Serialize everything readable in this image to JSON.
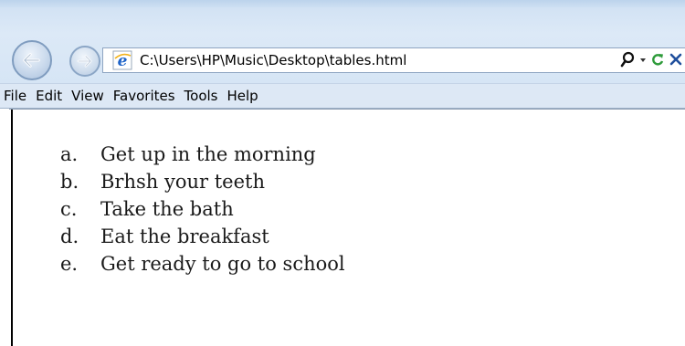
{
  "address_bar": {
    "url": "C:\\Users\\HP\\Music\\Desktop\\tables.html"
  },
  "toolbar_icons": {
    "back": "back-arrow-icon",
    "forward": "forward-arrow-icon",
    "page": "ie-logo-icon",
    "search": "search-icon",
    "dropdown": "dropdown-arrow-icon",
    "refresh": "refresh-icon",
    "stop": "close-icon"
  },
  "menu": {
    "items": [
      {
        "label": "File"
      },
      {
        "label": "Edit"
      },
      {
        "label": "View"
      },
      {
        "label": "Favorites"
      },
      {
        "label": "Tools"
      },
      {
        "label": "Help"
      }
    ]
  },
  "page": {
    "list": [
      {
        "marker": "a.",
        "text": "Get up in the morning"
      },
      {
        "marker": "b.",
        "text": "Brhsh your teeth"
      },
      {
        "marker": "c.",
        "text": "Take the bath"
      },
      {
        "marker": "d.",
        "text": "Eat the breakfast"
      },
      {
        "marker": "e.",
        "text": "Get ready to go to school"
      }
    ]
  },
  "colors": {
    "chrome_bg": "#d6e5f5",
    "menubar_bg": "#dde8f5",
    "refresh_green": "#2e9b3a",
    "stop_blue": "#1f4f9c"
  }
}
